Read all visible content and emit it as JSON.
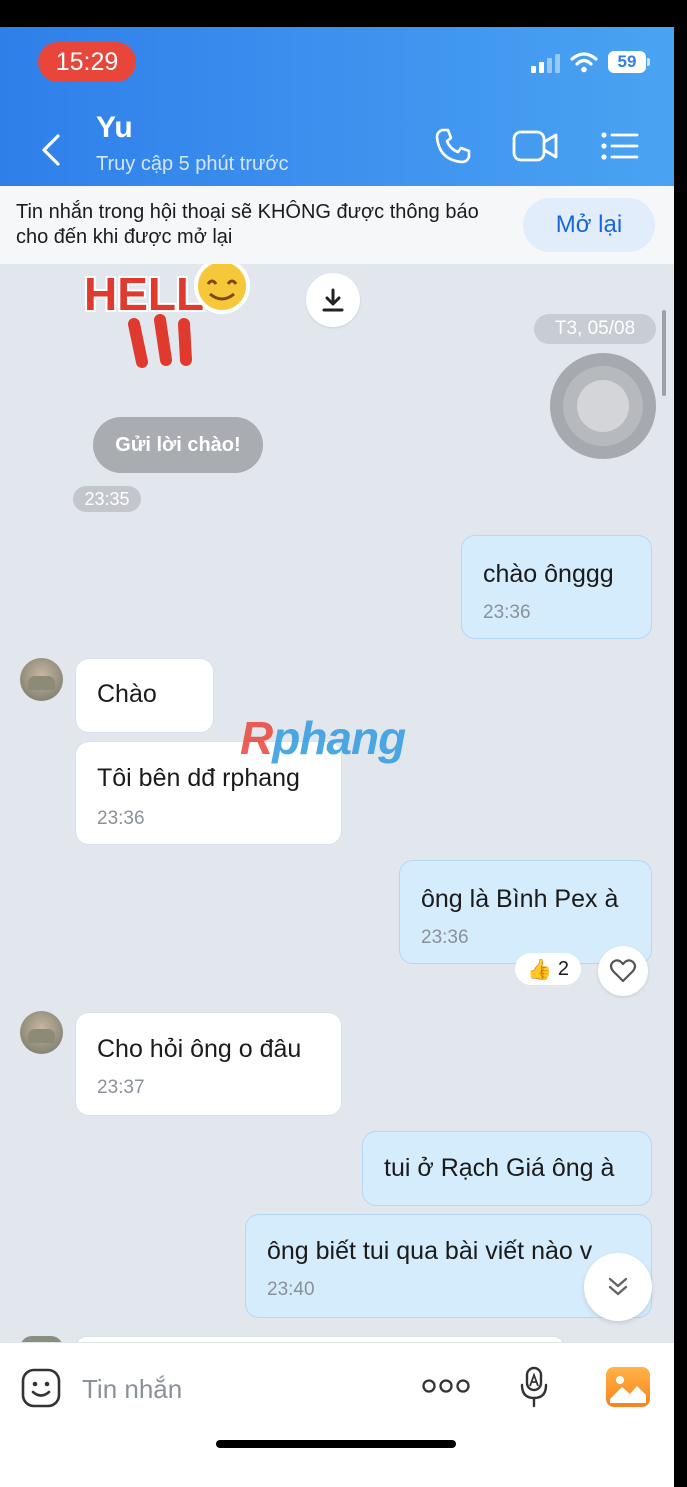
{
  "status_bar": {
    "time": "15:29",
    "battery": "59"
  },
  "header": {
    "title": "Yu",
    "subtitle": "Truy cập 5 phút trước"
  },
  "notice": {
    "text": "Tin nhắn trong hội thoại sẽ KHÔNG được thông báo cho đến khi được mở lại",
    "button": "Mở lại"
  },
  "sticker_text": "HELLO",
  "date_label": "T3, 05/08",
  "greeting": {
    "label": "Gửi lời chào!",
    "time": "23:35"
  },
  "messages": [
    {
      "dir": "out",
      "text": "chào ônggg",
      "time": "23:36"
    },
    {
      "dir": "in",
      "text": "Chào",
      "time": ""
    },
    {
      "dir": "in",
      "text": "Tôi bên dđ rphang",
      "time": "23:36"
    },
    {
      "dir": "out",
      "text": "ông là Bình Pex à",
      "time": "23:36",
      "reaction": {
        "emoji": "👍",
        "count": "2"
      }
    },
    {
      "dir": "in",
      "text": "Cho hỏi ông o đâu",
      "time": "23:37"
    },
    {
      "dir": "out",
      "text": "tui ở Rạch Giá ông à",
      "time": ""
    },
    {
      "dir": "out",
      "text": "ông biết tui qua bài viết nào v",
      "time": "23:40"
    }
  ],
  "watermark": {
    "part1": "R",
    "part2": "phang"
  },
  "composer": {
    "placeholder": "Tin nhắn"
  },
  "colors": {
    "header_start": "#2f7fea",
    "header_end": "#4aa3f2",
    "outgoing": "#d4ecfc",
    "incoming": "#ffffff",
    "accent": "#1a66d8"
  }
}
